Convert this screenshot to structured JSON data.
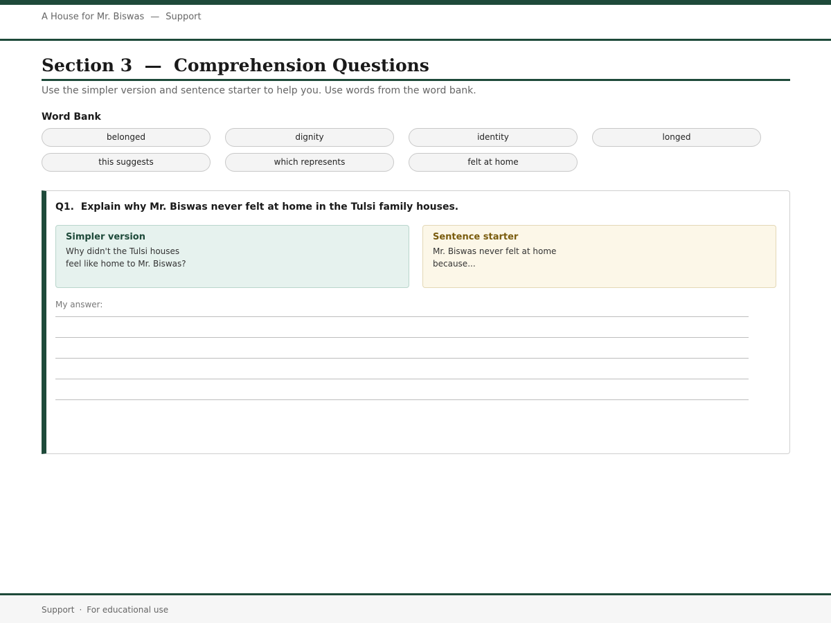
{
  "header": {
    "book_title": "A House for Mr. Biswas",
    "separator": "—",
    "section_name": "Support"
  },
  "page": {
    "title": "Section 3  —  Comprehension Questions",
    "instructions": "Use the simpler version and sentence starter to help you. Use words from the word bank."
  },
  "word_bank": {
    "label": "Word Bank",
    "words": [
      "belonged",
      "dignity",
      "identity",
      "longed",
      "this suggests",
      "which represents",
      "felt at home"
    ]
  },
  "questions": [
    {
      "text": "Q1.  Explain why Mr. Biswas never felt at home in the Tulsi family houses.",
      "simpler_title": "Simpler version",
      "simpler_text": "Why didn't the Tulsi houses feel like home to Mr. Biswas?",
      "starter_title": "Sentence starter",
      "starter_text": "Mr. Biswas never felt at home because...",
      "answer_label": "My answer:"
    }
  ],
  "footer": {
    "left": "Support",
    "separator": "·",
    "right": "For educational use"
  },
  "colors": {
    "accent": "#1e4a3a",
    "simpler_bg": "#e6f2ee",
    "starter_bg": "#fcf7e8",
    "starter_title": "#7a5c0e"
  }
}
